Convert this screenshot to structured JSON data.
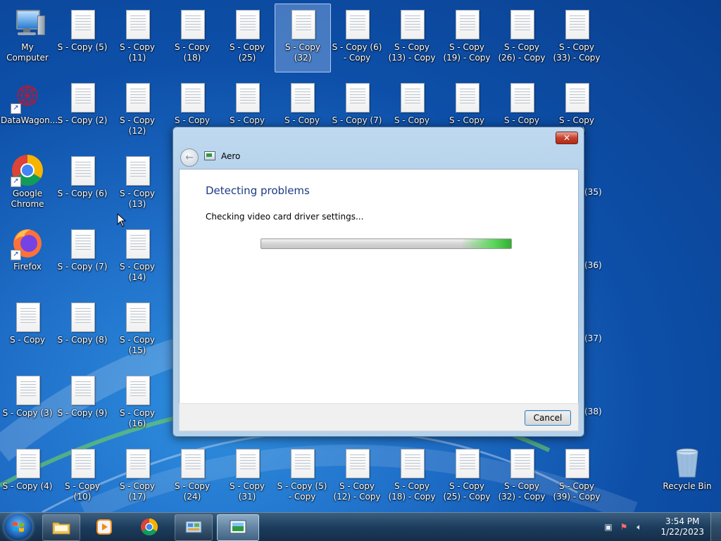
{
  "desktop": {
    "icons": [
      {
        "label": "My Computer"
      },
      {
        "label": "S - Copy (5)"
      },
      {
        "label": "S - Copy (11)"
      },
      {
        "label": "S - Copy (18)"
      },
      {
        "label": "S - Copy (25)"
      },
      {
        "label": "S - Copy (32)"
      },
      {
        "label": "S - Copy (6) - Copy"
      },
      {
        "label": "S - Copy (13) - Copy"
      },
      {
        "label": "S - Copy (19) - Copy"
      },
      {
        "label": "S - Copy (26) - Copy"
      },
      {
        "label": "S - Copy (33) - Copy"
      },
      {
        "label": "DataWagon..."
      },
      {
        "label": "S - Copy (2)"
      },
      {
        "label": "S - Copy (12)"
      },
      {
        "label": "S - Copy (20)"
      },
      {
        "label": "S - Copy (26)"
      },
      {
        "label": "S - Copy (33)"
      },
      {
        "label": "S - Copy (7) - Copy"
      },
      {
        "label": "S - Copy (14)"
      },
      {
        "label": "S - Copy (20)"
      },
      {
        "label": "S - Copy (27)"
      },
      {
        "label": "S - Copy (34)"
      },
      {
        "label": "Google Chrome"
      },
      {
        "label": "S - Copy (6)"
      },
      {
        "label": "S - Copy (13)"
      },
      {
        "label": "Firefox"
      },
      {
        "label": "S - Copy (7)"
      },
      {
        "label": "S - Copy (14)"
      },
      {
        "label": "S - Copy"
      },
      {
        "label": "S - Copy (8)"
      },
      {
        "label": "S - Copy (15)"
      },
      {
        "label": "S - Copy (3)"
      },
      {
        "label": "S - Copy (9)"
      },
      {
        "label": "S - Copy (16)"
      },
      {
        "label": "S - Copy (4)"
      },
      {
        "label": "S - Copy (10)"
      },
      {
        "label": "S - Copy (17)"
      },
      {
        "label": "S - Copy (24)"
      },
      {
        "label": "S - Copy (31)"
      },
      {
        "label": "S - Copy (5) - Copy"
      },
      {
        "label": "S - Copy (12) - Copy"
      },
      {
        "label": "S - Copy (18) - Copy"
      },
      {
        "label": "S - Copy (25) - Copy"
      },
      {
        "label": "S - Copy (32) - Copy"
      },
      {
        "label": "S - Copy (39) - Copy"
      },
      {
        "label": "Recycle Bin"
      }
    ],
    "partial_labels": [
      "(35)",
      "(36)",
      "(37)",
      "(38)"
    ]
  },
  "dialog": {
    "app_name": "Aero",
    "heading": "Detecting problems",
    "status": "Checking video card driver settings...",
    "close_label": "✕",
    "cancel_label": "Cancel",
    "progress_indeterminate": true
  },
  "taskbar": {
    "items": [
      "windows-explorer",
      "media-player",
      "google-chrome",
      "control-panel",
      "aero-troubleshooter"
    ],
    "active_item": "aero-troubleshooter"
  },
  "clock": {
    "time": "3:54 PM",
    "date": "1/22/2023"
  },
  "colors": {
    "heading": "#1c3a84",
    "progress_glow": "#31b031"
  }
}
